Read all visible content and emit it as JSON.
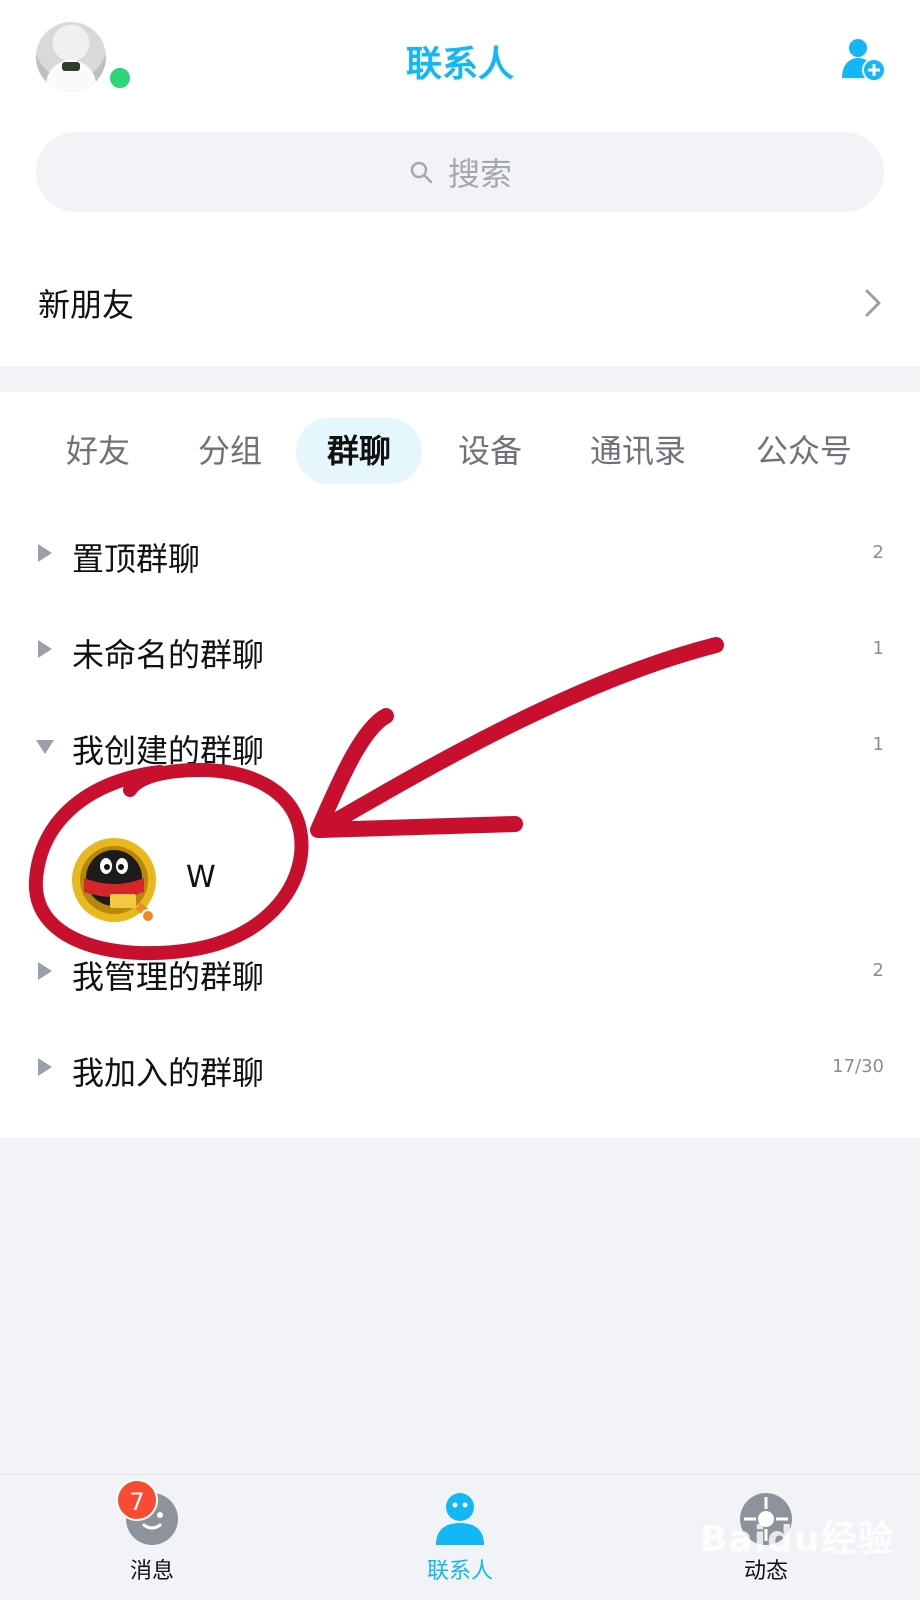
{
  "header": {
    "title": "联系人"
  },
  "search": {
    "placeholder": "搜索"
  },
  "new_friends": {
    "label": "新朋友"
  },
  "tabs": [
    {
      "label": "好友"
    },
    {
      "label": "分组"
    },
    {
      "label": "群聊",
      "active": true
    },
    {
      "label": "设备"
    },
    {
      "label": "通讯录"
    },
    {
      "label": "公众号"
    }
  ],
  "groups": [
    {
      "name": "置顶群聊",
      "count": "2",
      "expanded": false
    },
    {
      "name": "未命名的群聊",
      "count": "1",
      "expanded": false
    },
    {
      "name": "我创建的群聊",
      "count": "1",
      "expanded": true
    },
    {
      "name": "我管理的群聊",
      "count": "2",
      "expanded": false
    },
    {
      "name": "我加入的群聊",
      "count": "17/30",
      "expanded": false
    }
  ],
  "created_chats": [
    {
      "name": "W"
    }
  ],
  "bottom_nav": {
    "messages": {
      "label": "消息",
      "badge": "7"
    },
    "contacts": {
      "label": "联系人",
      "active": true
    },
    "feed": {
      "label": "动态"
    }
  },
  "watermark": "Baidu经验",
  "colors": {
    "accent": "#12b7f5",
    "online": "#2ed47a",
    "badge": "#f74c31",
    "annotation": "#c8102e"
  }
}
